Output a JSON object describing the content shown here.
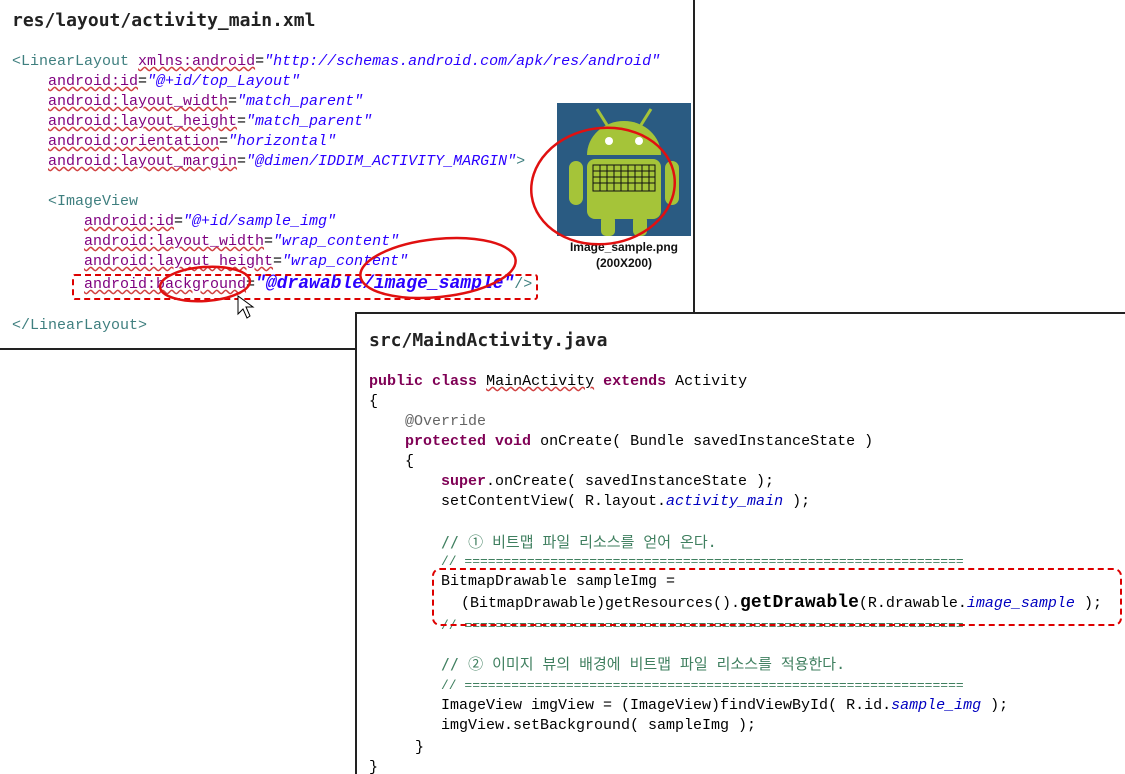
{
  "xml_panel": {
    "title": "res/layout/activity_main.xml",
    "l1": {
      "tag": "<LinearLayout",
      "attr": "xmlns:android",
      "val": "\"http://schemas.android.com/apk/res/android\""
    },
    "l2": {
      "attr": "android:id",
      "val": "\"@+id/top_Layout\""
    },
    "l3": {
      "attr": "android:layout_width",
      "val": "\"match_parent\""
    },
    "l4": {
      "attr": "android:layout_height",
      "val": "\"match_parent\""
    },
    "l5": {
      "attr": "android:orientation",
      "val": "\"horizontal\""
    },
    "l6": {
      "attr": "android:layout_margin",
      "val": "\"@dimen/IDDIM_ACTIVITY_MARGIN\"",
      "end": ">"
    },
    "l7": {
      "tag": "<ImageView"
    },
    "l8": {
      "attr": "android:id",
      "val": "\"@+id/sample_img\""
    },
    "l9": {
      "attr": "android:layout_width",
      "val": "\"wrap_content\""
    },
    "l10": {
      "attr": "android:layout_height",
      "val": "\"wrap_content\""
    },
    "l11": {
      "attr": "android:background",
      "val": "\"@drawable/image_sample\"",
      "end": "/>"
    },
    "l12": {
      "tag": "</LinearLayout>"
    },
    "image_caption": "Image_sample.png",
    "image_size": "(200X200)"
  },
  "java_panel": {
    "title": "src/MaindActivity.java",
    "j1": {
      "kw1": "public",
      "kw2": "class",
      "name": "MainActivity",
      "kw3": "extends",
      "parent": "Activity"
    },
    "j2": "{",
    "j3": "@Override",
    "j4": {
      "kw1": "protected",
      "kw2": "void",
      "rest": "onCreate( Bundle savedInstanceState )"
    },
    "j5": "{",
    "j6": {
      "kw": "super",
      "rest": ".onCreate( savedInstanceState );"
    },
    "j7": {
      "pre": "setContentView( R.layout.",
      "field": "activity_main",
      "post": " );"
    },
    "j8": "// ① 비트맵 파일 리소스를 얻어 온다.",
    "j9": "// ================================================================",
    "j10": "BitmapDrawable sampleImg =",
    "j11": {
      "pre": "(BitmapDrawable)getResources().",
      "method": "getDrawable",
      "mid": "(R.drawable.",
      "field": "image_sample",
      "post": " );"
    },
    "j12": "// ================================================================",
    "j13": "// ② 이미지 뷰의 배경에 비트맵 파일 리소스를 적용한다.",
    "j14": "// ================================================================",
    "j15": {
      "pre": "ImageView imgView = (ImageView)findViewById( R.id.",
      "field": "sample_img",
      "post": " );"
    },
    "j16": "imgView.setBackground( sampleImg );",
    "j17": "}",
    "j18": "}"
  }
}
